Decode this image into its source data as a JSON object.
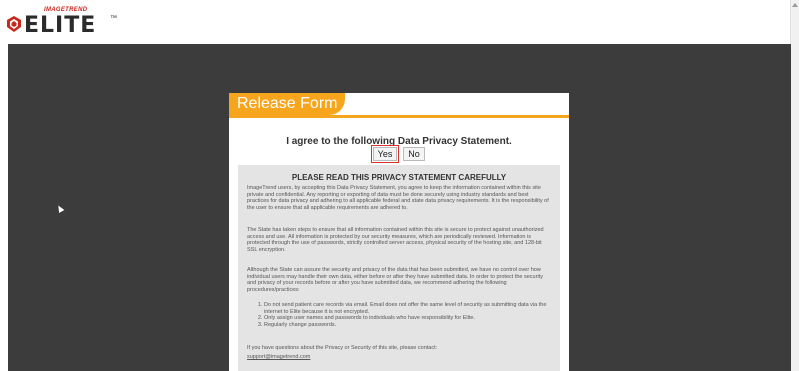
{
  "brand": {
    "small_text": "IMAGETREND",
    "name": "ELITE",
    "trademark": "™",
    "colors": {
      "accent": "#f7a51c",
      "brand_red": "#c8281e",
      "backdrop": "#3c3c3c"
    }
  },
  "modal": {
    "title": "Release Form",
    "agree_text": "I agree to the following Data Privacy Statement.",
    "yes_label": "Yes",
    "no_label": "No",
    "statement": {
      "heading": "PLEASE READ THIS PRIVACY STATEMENT CAREFULLY",
      "paragraphs": [
        "ImageTrend users, by accepting this Data Privacy Statement, you agree to keep the information contained within this site private and confidential. Any reporting or exporting of data must be done securely using industry standards and best practices for data privacy and adhering to all applicable federal and state data privacy requirements. It is the responsibility of the user to ensure that all applicable requirements are adhered to.",
        "The State has taken steps to ensure that all information contained within this site is secure to protect against unauthorized access and use. All information is protected by our security measures, which are periodically reviewed. Information is protected through the use of passwords, strictly controlled server access, physical security of the hosting site, and 128-bit SSL encryption.",
        "Although the State can assure the security and privacy of the data that has been submitted, we have no control over how individual users may handle their own data, either before or after they have submitted data. In order to protect the security and privacy of your records before or after you have submitted data, we recommend adhering the following procedures/practices:"
      ],
      "list": [
        "Do not send patient care records via email. Email does not offer the same level of security as submitting data via the internet to Elite because it is not encrypted.",
        "Only assign user names and passwords to individuals who have responsibility for Elite.",
        "Regularly change passwords."
      ],
      "contact_text": "If you have questions about the Privacy or Security of this site, please contact:",
      "contact_email": "support@imagetrend.com"
    }
  }
}
